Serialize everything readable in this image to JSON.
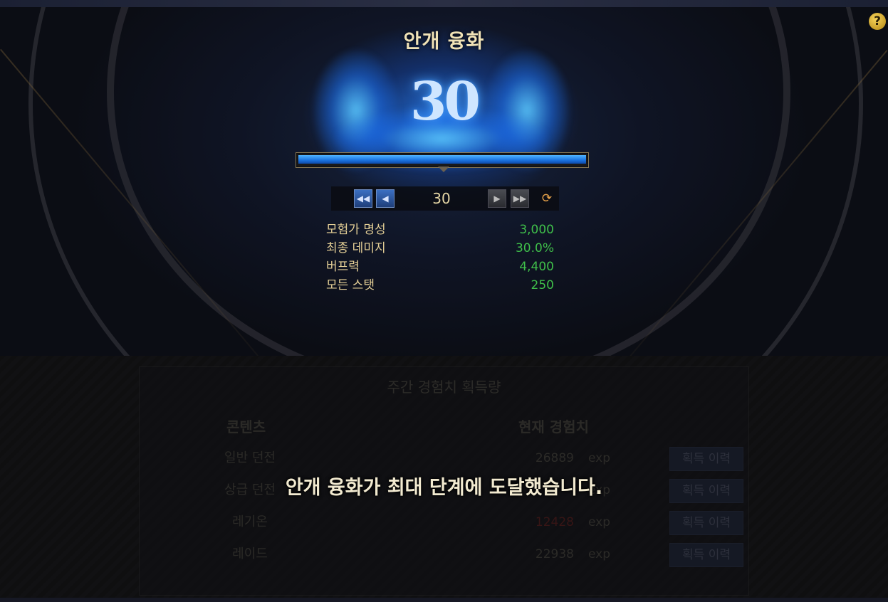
{
  "window": {
    "title": "안개 융화",
    "help_icon": "question-mark-icon"
  },
  "level": {
    "current": "30",
    "progress_fraction": 1.0
  },
  "stepper": {
    "value": "30",
    "first_icon": "double-left-arrow-icon",
    "prev_icon": "left-arrow-icon",
    "next_icon": "right-arrow-icon",
    "last_icon": "double-right-arrow-icon",
    "reset_icon": "refresh-icon"
  },
  "stats": [
    {
      "label": "모험가 명성",
      "value": "3,000"
    },
    {
      "label": "최종 데미지",
      "value": "30.0%"
    },
    {
      "label": "버프력",
      "value": "4,400"
    },
    {
      "label": "모든 스탯",
      "value": "250"
    }
  ],
  "weekly_exp": {
    "title": "주간 경험치 획득량",
    "col_content": "콘텐츠",
    "col_exp": "현재 경험치",
    "unit": "exp",
    "button_label": "획득 이력",
    "rows": [
      {
        "name": "일반 던전",
        "value": "26889"
      },
      {
        "name": "상급 던전",
        "value": ""
      },
      {
        "name": "레기온",
        "value": "12428"
      },
      {
        "name": "레이드",
        "value": "22938"
      }
    ]
  },
  "message": "안개 융화가 최대 단계에 도달했습니다.",
  "colors": {
    "accent_gold": "#e4cf96",
    "stat_green": "#3fbf4a",
    "progress_blue": "#1a72e0"
  }
}
